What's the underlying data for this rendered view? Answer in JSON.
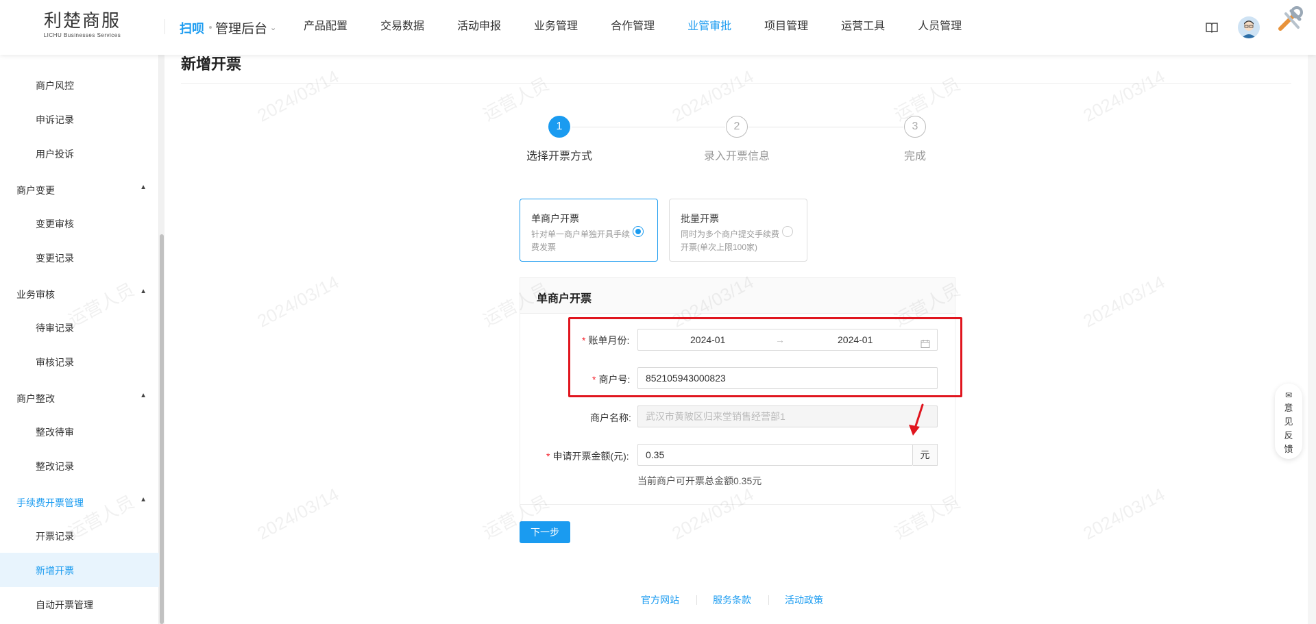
{
  "header": {
    "logo_cn": "利楚商服",
    "logo_en": "LICHU Businesses Services",
    "brand_mini": "扫呗",
    "switcher_label": "管理后台",
    "nav": [
      "产品配置",
      "交易数据",
      "活动申报",
      "业务管理",
      "合作管理",
      "业管审批",
      "项目管理",
      "运营工具",
      "人员管理"
    ],
    "nav_active": "业管审批"
  },
  "sidebar": {
    "items_top": [
      "商户风控",
      "申诉记录",
      "用户投诉"
    ],
    "groups": [
      {
        "label": "商户变更",
        "items": [
          "变更审核",
          "变更记录"
        ]
      },
      {
        "label": "业务审核",
        "items": [
          "待审记录",
          "审核记录"
        ]
      },
      {
        "label": "商户整改",
        "items": [
          "整改待审",
          "整改记录"
        ]
      },
      {
        "label": "手续费开票管理",
        "items": [
          "开票记录",
          "新增开票",
          "自动开票管理"
        ]
      }
    ],
    "active_group": "手续费开票管理",
    "active_item": "新增开票"
  },
  "page": {
    "title": "新增开票",
    "watermark_user": "运营人员",
    "watermark_date": "2024/03/14"
  },
  "steps": [
    {
      "num": "1",
      "label": "选择开票方式",
      "state": "done"
    },
    {
      "num": "2",
      "label": "录入开票信息",
      "state": "todo"
    },
    {
      "num": "3",
      "label": "完成",
      "state": "todo"
    }
  ],
  "options": [
    {
      "title": "单商户开票",
      "desc": "针对单一商户单独开具手续费发票",
      "selected": true
    },
    {
      "title": "批量开票",
      "desc": "同时为多个商户提交手续费开票(单次上限100家)",
      "selected": false
    }
  ],
  "form": {
    "panel_title": "单商户开票",
    "bill_month_label": "账单月份",
    "bill_month_start": "2024-01",
    "bill_month_end": "2024-01",
    "merchant_no_label": "商户号",
    "merchant_no_value": "852105943000823",
    "merchant_name_label": "商户名称",
    "merchant_name_value": "武汉市黄陂区归来堂销售经营部1",
    "amount_label": "申请开票金额(元)",
    "amount_value": "0.35",
    "amount_unit": "元",
    "amount_hint": "当前商户可开票总金额0.35元",
    "colon": ":",
    "next_button": "下一步"
  },
  "footer": [
    "官方网站",
    "服务条款",
    "活动政策"
  ],
  "feedback": {
    "label": "意见反馈"
  },
  "colors": {
    "accent": "#1a9bf0",
    "required": "#f5222d",
    "highlight": "#e0151e"
  }
}
